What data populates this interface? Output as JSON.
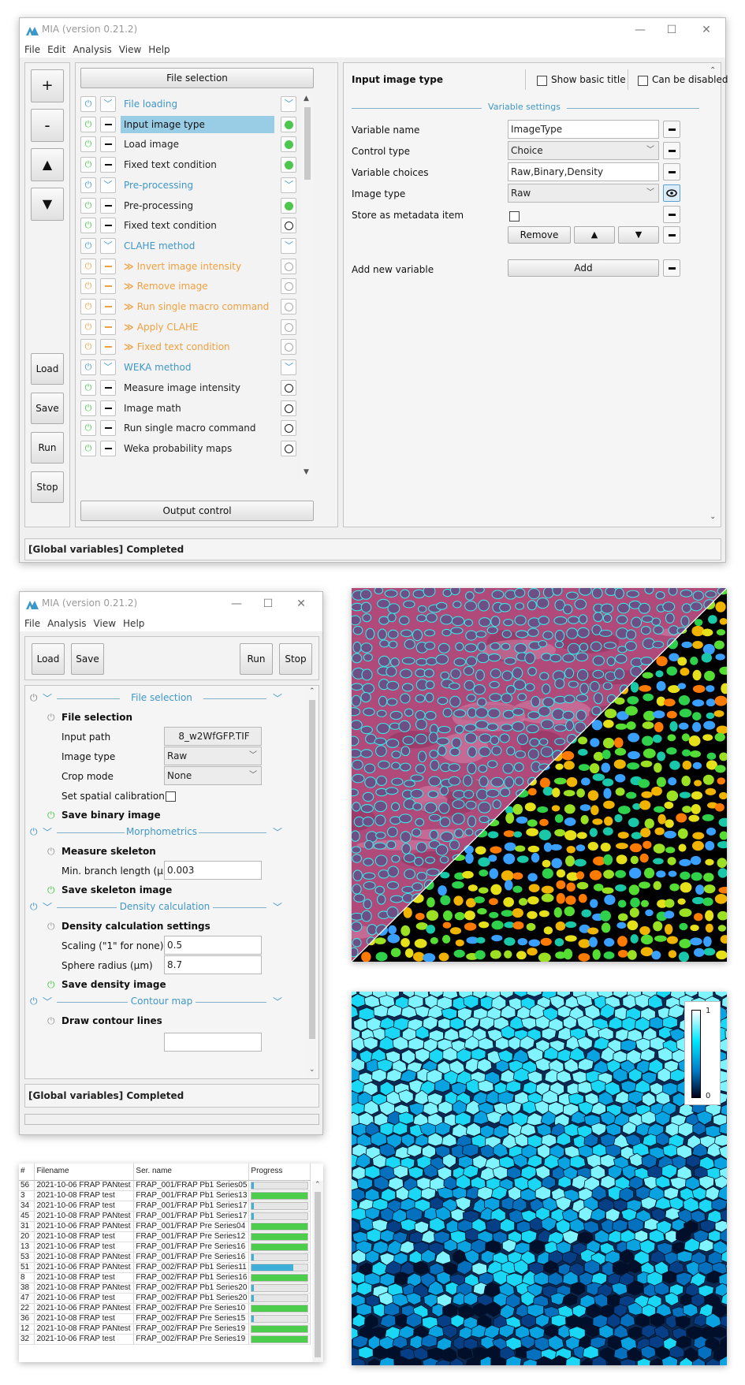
{
  "app": {
    "title": "MIA (version 0.21.2)"
  },
  "menu": [
    "File",
    "Edit",
    "Analysis",
    "View",
    "Help"
  ],
  "menu_small": [
    "File",
    "Analysis",
    "View",
    "Help"
  ],
  "side_buttons": {
    "add": "+",
    "remove": "-",
    "up": "▲",
    "down": "▼",
    "load": "Load",
    "save": "Save",
    "run": "Run",
    "stop": "Stop"
  },
  "workflow": {
    "file_selection": "File selection",
    "output_control": "Output control",
    "modules": [
      {
        "label": "File loading",
        "kind": "group",
        "state": "group"
      },
      {
        "label": "Input image type",
        "kind": "normal",
        "state": "ok",
        "selected": true
      },
      {
        "label": "Load image",
        "kind": "normal",
        "state": "ok"
      },
      {
        "label": "Fixed text condition",
        "kind": "normal",
        "state": "ok"
      },
      {
        "label": "Pre-processing",
        "kind": "group",
        "state": "group"
      },
      {
        "label": "Pre-processing",
        "kind": "normal",
        "state": "ok"
      },
      {
        "label": "Fixed text condition",
        "kind": "normal",
        "state": "check"
      },
      {
        "label": "CLAHE method",
        "kind": "group",
        "state": "group"
      },
      {
        "label": "Invert image intensity",
        "kind": "disabled",
        "state": "grey"
      },
      {
        "label": "Remove image",
        "kind": "disabled",
        "state": "grey"
      },
      {
        "label": "Run single macro command",
        "kind": "disabled",
        "state": "grey"
      },
      {
        "label": "Apply CLAHE",
        "kind": "disabled",
        "state": "grey"
      },
      {
        "label": "Fixed text condition",
        "kind": "disabled",
        "state": "grey"
      },
      {
        "label": "WEKA method",
        "kind": "group",
        "state": "group"
      },
      {
        "label": "Measure image intensity",
        "kind": "normal",
        "state": "check"
      },
      {
        "label": "Image math",
        "kind": "normal",
        "state": "check"
      },
      {
        "label": "Run single macro command",
        "kind": "normal",
        "state": "check"
      },
      {
        "label": "Weka probability maps",
        "kind": "normal",
        "state": "check"
      }
    ]
  },
  "params": {
    "title": "Input image type",
    "show_basic_title": "Show basic title",
    "can_be_disabled": "Can be disabled",
    "section": "Variable settings",
    "variable_name_label": "Variable name",
    "variable_name_value": "ImageType",
    "control_type_label": "Control type",
    "control_type_value": "Choice",
    "variable_choices_label": "Variable choices",
    "variable_choices_value": "Raw,Binary,Density",
    "image_type_label": "Image type",
    "image_type_value": "Raw",
    "store_metadata_label": "Store as metadata item",
    "remove_label": "Remove",
    "up": "▲",
    "down": "▼",
    "add_new_label": "Add new variable",
    "add_label": "Add"
  },
  "status": "[Global variables] Completed",
  "small": {
    "load": "Load",
    "save": "Save",
    "run": "Run",
    "stop": "Stop",
    "sections": {
      "file_selection": "File selection",
      "morphometrics": "Morphometrics",
      "density": "Density calculation",
      "contour": "Contour map"
    },
    "file_selection_mod": "File selection",
    "input_path_label": "Input path",
    "input_path_value": "8_w2WfGFP.TIF",
    "image_type_label": "Image type",
    "image_type_value": "Raw",
    "crop_mode_label": "Crop mode",
    "crop_mode_value": "None",
    "spatial_label": "Set spatial calibration",
    "save_binary": "Save binary image",
    "measure_skeleton": "Measure skeleton",
    "min_branch_label": "Min. branch length (µm)",
    "min_branch_value": "0.003",
    "save_skeleton": "Save skeleton image",
    "density_settings": "Density calculation settings",
    "scaling_label": "Scaling (\"1\" for none)",
    "scaling_value": "0.5",
    "sphere_label": "Sphere radius (µm)",
    "sphere_value": "8.7",
    "save_density": "Save density image",
    "draw_contour": "Draw contour lines",
    "status": "[Global variables] Completed"
  },
  "table": {
    "headers": [
      "#",
      "Filename",
      "Ser. name",
      "Progress"
    ],
    "rows": [
      {
        "n": "56",
        "file": "2021-10-06 FRAP PANtest",
        "ser": "FRAP_001/FRAP Pb1 Series05",
        "p": 0.03
      },
      {
        "n": "3",
        "file": "2021-10-08 FRAP test",
        "ser": "FRAP_001/FRAP Pb1 Series13",
        "p": 1.0
      },
      {
        "n": "34",
        "file": "2021-10-06 FRAP test",
        "ser": "FRAP_001/FRAP Pb1 Series17",
        "p": 0.03
      },
      {
        "n": "45",
        "file": "2021-10-08 FRAP PANtest",
        "ser": "FRAP_001/FRAP Pb1 Series17",
        "p": 0.03
      },
      {
        "n": "31",
        "file": "2021-10-06 FRAP PANtest",
        "ser": "FRAP_001/FRAP Pre Series04",
        "p": 1.0
      },
      {
        "n": "20",
        "file": "2021-10-08 FRAP test",
        "ser": "FRAP_001/FRAP Pre Series12",
        "p": 1.0
      },
      {
        "n": "13",
        "file": "2021-10-06 FRAP test",
        "ser": "FRAP_001/FRAP Pre Series16",
        "p": 1.0
      },
      {
        "n": "53",
        "file": "2021-10-08 FRAP PANtest",
        "ser": "FRAP_001/FRAP Pre Series16",
        "p": 0.03
      },
      {
        "n": "51",
        "file": "2021-10-06 FRAP PANtest",
        "ser": "FRAP_002/FRAP Pb1 Series11",
        "p": 0.75
      },
      {
        "n": "8",
        "file": "2021-10-08 FRAP test",
        "ser": "FRAP_002/FRAP Pb1 Series16",
        "p": 1.0
      },
      {
        "n": "38",
        "file": "2021-10-08 FRAP PANtest",
        "ser": "FRAP_002/FRAP Pb1 Series20",
        "p": 0.03
      },
      {
        "n": "47",
        "file": "2021-10-06 FRAP test",
        "ser": "FRAP_002/FRAP Pb1 Series20",
        "p": 0.03
      },
      {
        "n": "22",
        "file": "2021-10-06 FRAP PANtest",
        "ser": "FRAP_002/FRAP Pre Series10",
        "p": 1.0
      },
      {
        "n": "36",
        "file": "2021-10-08 FRAP test",
        "ser": "FRAP_002/FRAP Pre Series15",
        "p": 0.03
      },
      {
        "n": "12",
        "file": "2021-10-08 FRAP PANtest",
        "ser": "FRAP_002/FRAP Pre Series19",
        "p": 1.0
      },
      {
        "n": "32",
        "file": "2021-10-06 FRAP test",
        "ser": "FRAP_002/FRAP Pre Series19",
        "p": 1.0
      }
    ]
  },
  "colorbar": {
    "max": "1",
    "min": "0"
  },
  "colors": {
    "accent_blue": "#3f97c9",
    "disabled_orange": "#f0a040",
    "ok_green": "#4cc64c",
    "selected_row": "#99cde6",
    "progress_green": "#4ccd4c",
    "progress_blue": "#3fb0d8"
  }
}
